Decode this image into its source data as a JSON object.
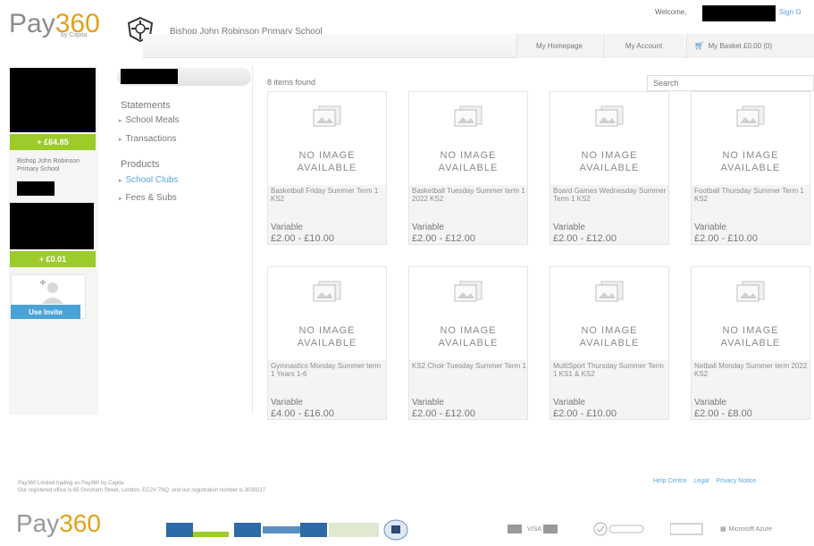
{
  "header": {
    "logo_main": "Pay",
    "logo_num": "360",
    "logo_sub": "by Capita",
    "school_name": "Bishop John Robinson Primary School",
    "welcome": "Welcome,",
    "signout": "Sign O",
    "nav": {
      "home": "My Homepage",
      "account": "My Account",
      "basket": "My Basket £0.00 (0)"
    }
  },
  "profile": {
    "child1_balance": "+ £64.85",
    "child1_school": "Bishop John Robinson Primary School",
    "child2_balance": "+ £0.01",
    "invite_button": "Use Invite"
  },
  "menu": {
    "statements_heading": "Statements",
    "statements_items": [
      "School Meals",
      "Transactions"
    ],
    "products_heading": "Products",
    "products_items": [
      "School Clubs",
      "Fees & Subs"
    ]
  },
  "main": {
    "items_found": "8 items found",
    "search_placeholder": "Search",
    "no_image_line1": "NO IMAGE",
    "no_image_line2": "AVAILABLE",
    "products": [
      {
        "title": "Basketball Friday Summer Term 1 KS2",
        "price_label": "Variable",
        "price": "£2.00 - £10.00"
      },
      {
        "title": "Basketball Tuesday Summer term 1 2022 KS2",
        "price_label": "Variable",
        "price": "£2.00 - £12.00"
      },
      {
        "title": "Board Games Wednesday Summer Term 1 KS2",
        "price_label": "Variable",
        "price": "£2.00 - £12.00"
      },
      {
        "title": "Football Thursday Summer Term 1 KS2",
        "price_label": "Variable",
        "price": "£2.00 - £10.00"
      },
      {
        "title": "Gymnastics Monday Summer term 1 Years 1-6",
        "price_label": "Variable",
        "price": "£4.00 - £16.00"
      },
      {
        "title": "KS2 Choir Tuesday Summer Term 1",
        "price_label": "Variable",
        "price": "£2.00 - £12.00"
      },
      {
        "title": "MultiSport Thursday Summer Term 1 KS1 & KS2",
        "price_label": "Variable",
        "price": "£2.00 - £10.00"
      },
      {
        "title": "Netball Monday Summer term 2022 KS2",
        "price_label": "Variable",
        "price": "£2.00 - £8.00"
      }
    ]
  },
  "footer": {
    "line1": "Pay360 Limited trading as Pay360 by Capita",
    "line2": "Our registered office is 65 Gresham Street, London, EC2V 7NQ, and our registration number is 3030217",
    "links": [
      "Help Centre",
      "Legal",
      "Privacy Notice"
    ],
    "logo_main": "Pay",
    "logo_num": "360",
    "badges": [
      "VISA",
      "Microsoft Azure"
    ]
  },
  "colors": {
    "brand_orange": "#e0a21a",
    "balance_green": "#9ccb2a",
    "link_blue": "#5aa8dd",
    "invite_blue": "#4aa3d6"
  }
}
